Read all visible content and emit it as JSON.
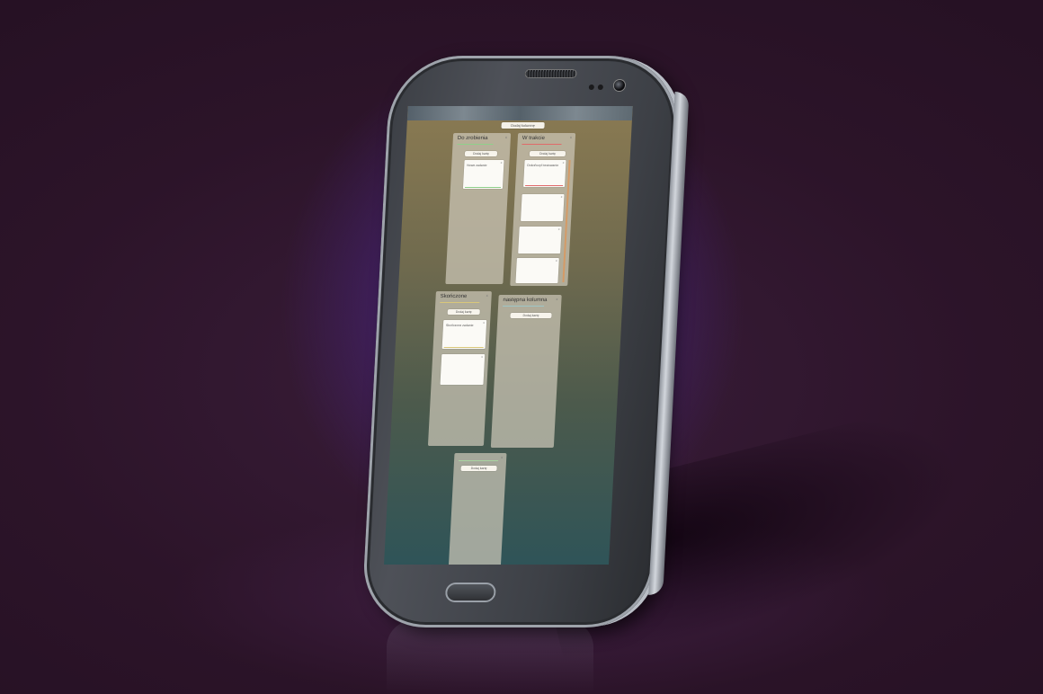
{
  "toolbar": {
    "add_column_label": "Dodaj kolumnę"
  },
  "columns": [
    {
      "title": "Do zrobienia",
      "accent": "#8fd08a",
      "add_card_label": "Dodaj kartę",
      "close": "x",
      "cards": [
        {
          "text": "Nowe zadanie",
          "accent": "#8fd08a"
        }
      ]
    },
    {
      "title": "W trakcie",
      "accent": "#e06a6a",
      "add_card_label": "Dodaj kartę",
      "close": "x",
      "cards": [
        {
          "text": "Dokończyć testowanie",
          "accent": "#e06a6a"
        },
        {
          "text": "",
          "accent": ""
        },
        {
          "text": "",
          "accent": ""
        },
        {
          "text": "",
          "accent": ""
        }
      ]
    },
    {
      "title": "Skończone",
      "accent": "#d9c77a",
      "add_card_label": "Dodaj kartę",
      "close": "x",
      "cards": [
        {
          "text": "Skończone zadanie",
          "accent": "#d9c77a"
        },
        {
          "text": "",
          "accent": ""
        }
      ]
    },
    {
      "title": "następna kolumna",
      "accent": "#9fc6c6",
      "add_card_label": "Dodaj kartę",
      "close": "x",
      "cards": []
    },
    {
      "title": "",
      "accent": "#a8d4a0",
      "add_card_label": "Dodaj kartę",
      "close": "x",
      "cards": []
    }
  ],
  "colors": {
    "background": "#2c1429",
    "glow": "#5f37af",
    "screen_top": "#8a7a52",
    "screen_bottom": "#2f5458"
  }
}
